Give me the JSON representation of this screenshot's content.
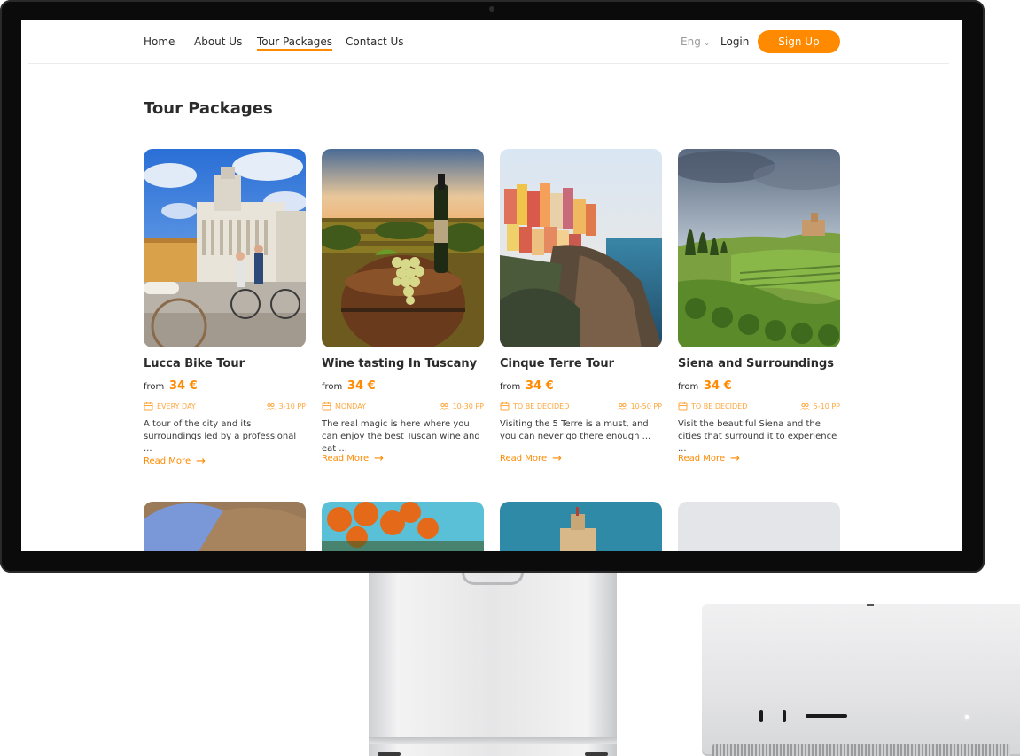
{
  "nav": {
    "links": [
      {
        "label": "Home",
        "active": false
      },
      {
        "label": "About Us",
        "active": false
      },
      {
        "label": "Tour Packages",
        "active": true
      },
      {
        "label": "Contact Us",
        "active": false
      }
    ],
    "language": "Eng",
    "language_icon": "chevron-down-icon",
    "login_label": "Login",
    "signup_label": "Sign Up"
  },
  "page": {
    "title": "Tour Packages"
  },
  "tours": [
    {
      "title": "Lucca Bike Tour",
      "from_label": "from",
      "price": "34 €",
      "schedule": "EVERY DAY",
      "group": "3-10 PP",
      "description": "A tour of the city and its surroundings led by a professional ...",
      "read_more": "Read More",
      "photo": "lucca-cathedral-bikes"
    },
    {
      "title": "Wine tasting In Tuscany",
      "from_label": "from",
      "price": "34 €",
      "schedule": "MONDAY",
      "group": "10-30 PP",
      "description": "The real magic is here where you can enjoy the best Tuscan wine and eat ...",
      "read_more": "Read More",
      "photo": "wine-barrel-grapes"
    },
    {
      "title": "Cinque Terre Tour",
      "from_label": "from",
      "price": "34 €",
      "schedule": "TO BE DECIDED",
      "group": "10-50 PP",
      "description": "Visiting the 5 Terre is a must, and you can never go there enough ...",
      "read_more": "Read More",
      "photo": "cinque-terre-cliff-village"
    },
    {
      "title": "Siena and Surroundings",
      "from_label": "from",
      "price": "34 €",
      "schedule": "TO BE DECIDED",
      "group": "5-10 PP",
      "description": "Visit the beautiful Siena and the cities that surround it to experience ...",
      "read_more": "Read More",
      "photo": "siena-cypress-hills"
    }
  ],
  "icons": {
    "schedule": "calendar-icon",
    "group": "group-icon",
    "read_more": "arrow-right-icon"
  },
  "colors": {
    "accent": "#ff8a00",
    "meta": "#ffa63d",
    "text": "#2b2b2b"
  }
}
